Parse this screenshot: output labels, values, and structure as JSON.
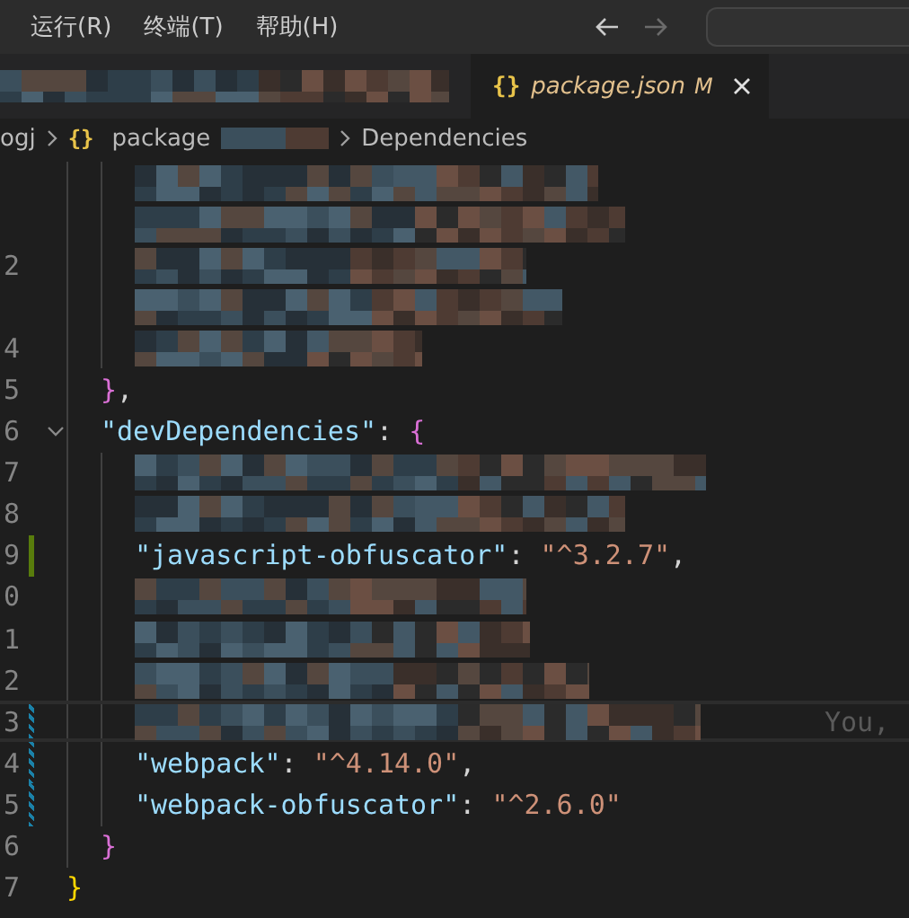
{
  "menu": [
    {
      "label": "运行(R)"
    },
    {
      "label": "终端(T)"
    },
    {
      "label": "帮助(H)"
    }
  ],
  "tabs": [
    {
      "kind": "redacted",
      "selected": false
    },
    {
      "kind": "file",
      "icon": "{}",
      "label": "package.json",
      "badge": "M",
      "selected": true
    }
  ],
  "breadcrumb": [
    {
      "kind": "text",
      "label": "ogj"
    },
    {
      "kind": "file",
      "icon": "{}",
      "label": "package"
    },
    {
      "kind": "redacted"
    },
    {
      "kind": "text",
      "label": "Dependencies"
    }
  ],
  "lines": [
    {
      "kind": "group",
      "children": [
        {
          "kind": "group",
          "children": [
            {
              "kind": "redacted"
            },
            {
              "kind": "redacted"
            },
            {
              "kind": "redacted",
              "number": "2"
            },
            {
              "kind": "redacted"
            },
            {
              "kind": "redacted",
              "number": "4"
            }
          ]
        },
        {
          "kind": "code",
          "number": "5",
          "tokens": [
            {
              "kind": "bracket2",
              "text": "}"
            },
            {
              "kind": "punct",
              "text": ","
            }
          ]
        },
        {
          "kind": "code",
          "number": "6",
          "fold": true,
          "tokens": [
            {
              "kind": "key",
              "text": "\"devDependencies\""
            },
            {
              "kind": "punct",
              "text": ": "
            },
            {
              "kind": "bracket2",
              "text": "{"
            }
          ],
          "children": [
            {
              "kind": "redacted",
              "number": "7"
            },
            {
              "kind": "redacted",
              "number": "8"
            },
            {
              "kind": "code",
              "number": "9",
              "added": true,
              "tokens": [
                {
                  "kind": "key",
                  "text": "\"javascript-obfuscator\""
                },
                {
                  "kind": "punct",
                  "text": ": "
                },
                {
                  "kind": "value",
                  "text": "\"^3.2.7\""
                },
                {
                  "kind": "punct",
                  "text": ","
                }
              ]
            },
            {
              "kind": "redacted",
              "number": "0"
            },
            {
              "kind": "redacted",
              "number": "1"
            },
            {
              "kind": "redacted",
              "number": "2"
            },
            {
              "kind": "redacted",
              "number": "3",
              "modified": true,
              "current": true,
              "blame": "You,"
            },
            {
              "kind": "code",
              "number": "4",
              "modified": true,
              "tokens": [
                {
                  "kind": "key",
                  "text": "\"webpack\""
                },
                {
                  "kind": "punct",
                  "text": ": "
                },
                {
                  "kind": "value",
                  "text": "\"^4.14.0\""
                },
                {
                  "kind": "punct",
                  "text": ","
                }
              ]
            },
            {
              "kind": "code",
              "number": "5",
              "modified": true,
              "tokens": [
                {
                  "kind": "key",
                  "text": "\"webpack-obfuscator\""
                },
                {
                  "kind": "punct",
                  "text": ": "
                },
                {
                  "kind": "value",
                  "text": "\"^2.6.0\""
                }
              ]
            }
          ]
        },
        {
          "kind": "code",
          "number": "6",
          "tokens": [
            {
              "kind": "bracket2",
              "text": "}"
            }
          ]
        }
      ]
    },
    {
      "kind": "code",
      "number": "7",
      "tokens": [
        {
          "kind": "bracket1",
          "text": "}"
        }
      ]
    }
  ]
}
